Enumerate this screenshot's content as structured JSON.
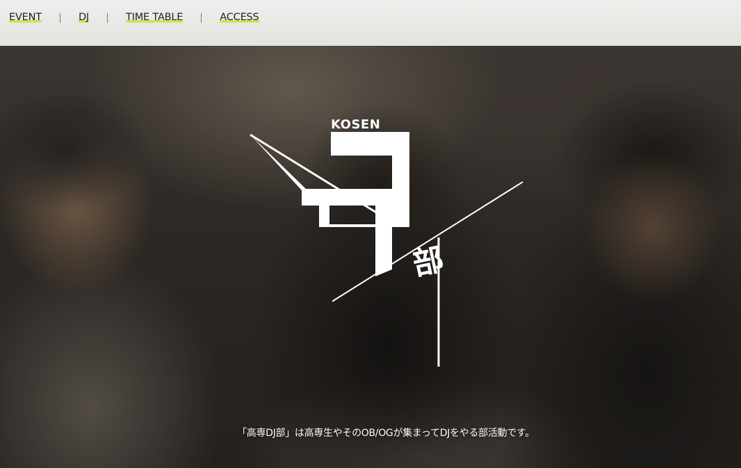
{
  "nav": {
    "items": [
      {
        "label": "EVENT"
      },
      {
        "label": "DJ"
      },
      {
        "label": "TIME TABLE"
      },
      {
        "label": "ACCESS"
      }
    ],
    "accent_color": "#c6e84a"
  },
  "hero": {
    "logo_text": "KOSEN",
    "logo_kanji": "部",
    "tagline": "「高専DJ部」は高専生やそのOB/OGが集まってDJをやる部活動です。"
  }
}
